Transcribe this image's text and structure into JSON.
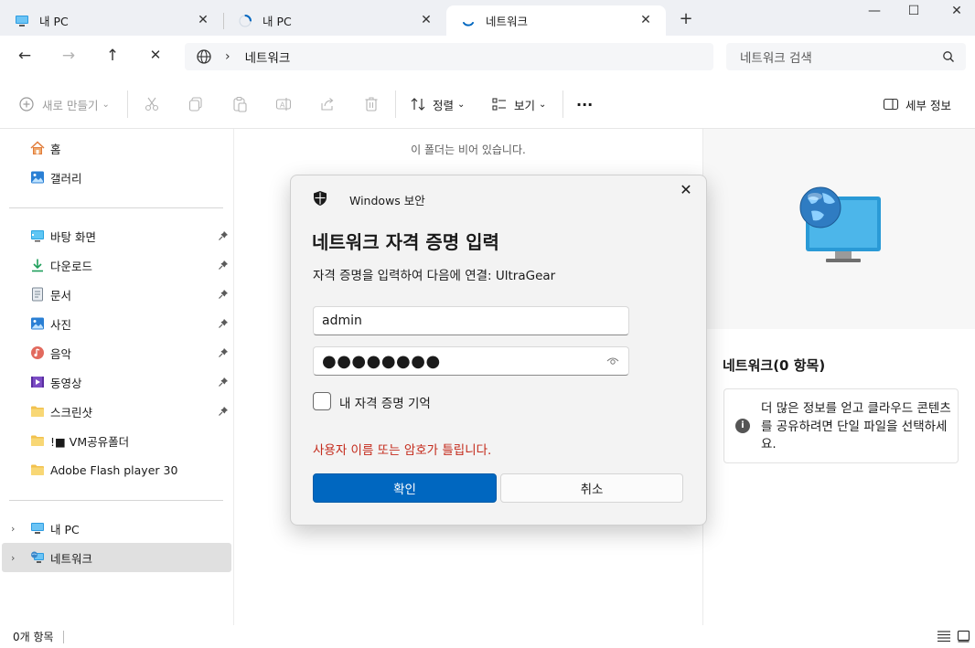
{
  "tabs": [
    {
      "label": "내 PC",
      "icon": "monitor-icon",
      "close": "✕"
    },
    {
      "label": "내 PC",
      "icon": "loading-spinner-icon",
      "close": "✕"
    },
    {
      "label": "네트워크",
      "icon": "loading-spinner-icon",
      "close": "✕"
    }
  ],
  "new_tab": "+",
  "window_controls": {
    "minimize": "—",
    "maximize": "☐",
    "close": "✕"
  },
  "nav": {
    "back": "←",
    "forward": "→",
    "up": "↑",
    "stop": "✕",
    "crumb_separator": "›",
    "breadcrumb": "네트워크",
    "search_placeholder": "네트워크 검색"
  },
  "toolbar": {
    "new_label": "새로 만들기",
    "sort_label": "정렬",
    "view_label": "보기",
    "more": "···",
    "details_label": "세부 정보",
    "caret": "⌄"
  },
  "sidebar": {
    "top_items": [
      {
        "label": "홈",
        "icon": "home-icon"
      },
      {
        "label": "갤러리",
        "icon": "gallery-icon"
      }
    ],
    "pinned_items": [
      {
        "label": "바탕 화면",
        "icon": "desktop-folder-icon",
        "pinned": true
      },
      {
        "label": "다운로드",
        "icon": "download-folder-icon",
        "pinned": true
      },
      {
        "label": "문서",
        "icon": "documents-folder-icon",
        "pinned": true
      },
      {
        "label": "사진",
        "icon": "pictures-folder-icon",
        "pinned": true
      },
      {
        "label": "음악",
        "icon": "music-folder-icon",
        "pinned": true
      },
      {
        "label": "동영상",
        "icon": "videos-folder-icon",
        "pinned": true
      },
      {
        "label": "스크린샷",
        "icon": "folder-icon",
        "pinned": true
      },
      {
        "label": "!■ VM공유폴더",
        "icon": "folder-icon",
        "pinned": false
      },
      {
        "label": "Adobe Flash player 30",
        "icon": "folder-icon",
        "pinned": false
      }
    ],
    "tree_items": [
      {
        "label": "내 PC",
        "icon": "monitor-icon",
        "selected": false
      },
      {
        "label": "네트워크",
        "icon": "network-icon",
        "selected": true
      }
    ],
    "expander": "›",
    "pin_glyph": "📌"
  },
  "main": {
    "empty_message": "이 폴더는 비어 있습니다."
  },
  "details": {
    "title": "네트워크(0 항목)",
    "info_text": "더 많은 정보를 얻고 클라우드 콘텐츠를 공유하려면 단일 파일을 선택하세요.",
    "info_glyph": "i"
  },
  "statusbar": {
    "item_count": "0개 항목"
  },
  "dialog": {
    "app_name": "Windows 보안",
    "close": "✕",
    "title": "네트워크 자격 증명 입력",
    "description": "자격 증명을 입력하여 다음에 연결: UltraGear",
    "username_value": "admin",
    "password_masked": "●●●●●●●●",
    "remember_label": "내 자격 증명 기억",
    "remember_checked": false,
    "error_text": "사용자 이름 또는 암호가 틀립니다.",
    "ok_label": "확인",
    "cancel_label": "취소"
  },
  "colors": {
    "accent": "#0067c0",
    "error": "#c42b1c",
    "selected_row": "#e0e0e0",
    "titlebar_bg": "#eef0f4"
  }
}
